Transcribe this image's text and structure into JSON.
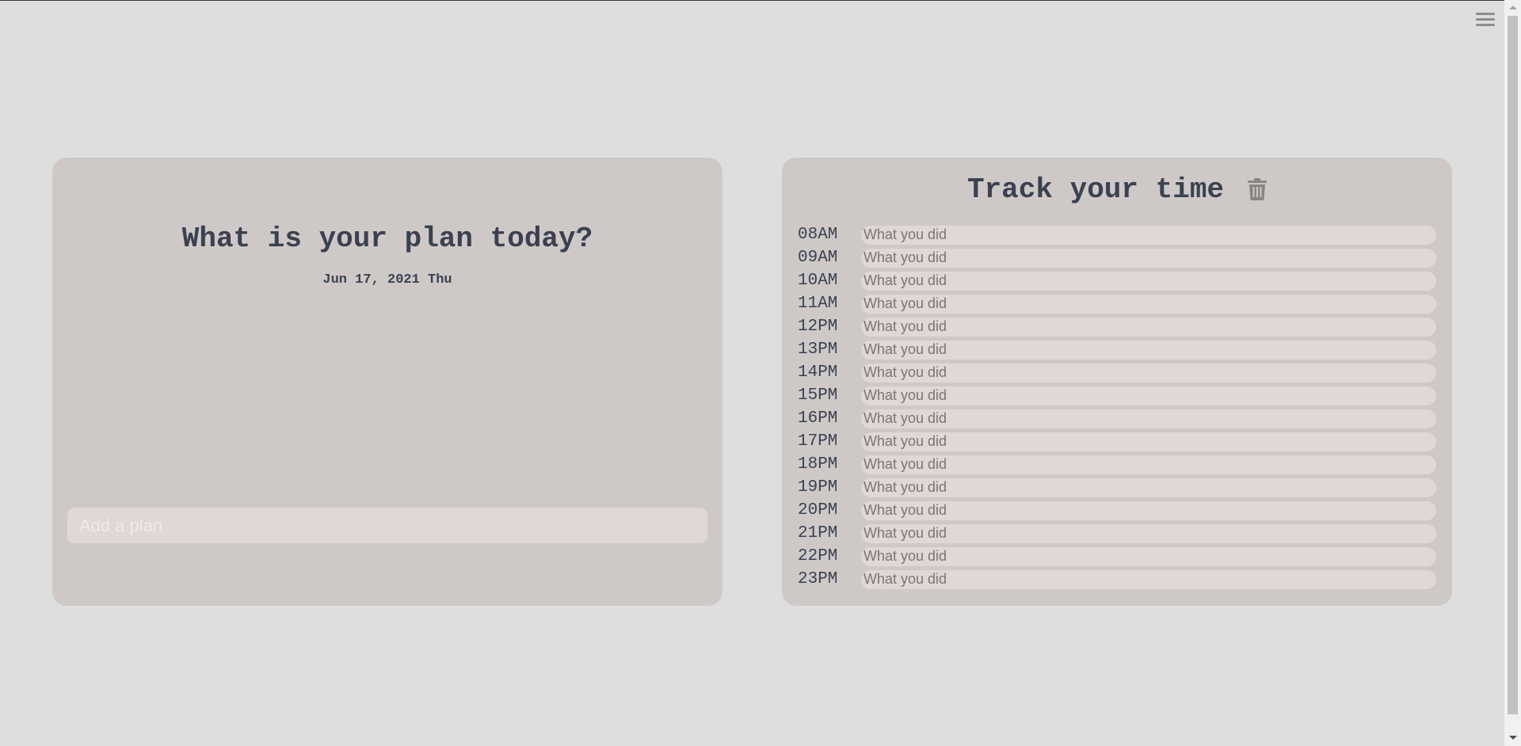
{
  "plan": {
    "title": "What is your plan today?",
    "date": "Jun 17, 2021 Thu",
    "input_placeholder": "Add a plan"
  },
  "tracker": {
    "title": "Track your time",
    "trash_icon": "trash-icon",
    "entry_placeholder": "What you did",
    "hours": [
      "08AM",
      "09AM",
      "10AM",
      "11AM",
      "12PM",
      "13PM",
      "14PM",
      "15PM",
      "16PM",
      "17PM",
      "18PM",
      "19PM",
      "20PM",
      "21PM",
      "22PM",
      "23PM"
    ]
  },
  "menu_icon": "hamburger-menu-icon",
  "colors": {
    "background": "#dfdedf",
    "panel": "#cec9c7",
    "input": "#e0d7d7",
    "text": "#3b4150"
  }
}
